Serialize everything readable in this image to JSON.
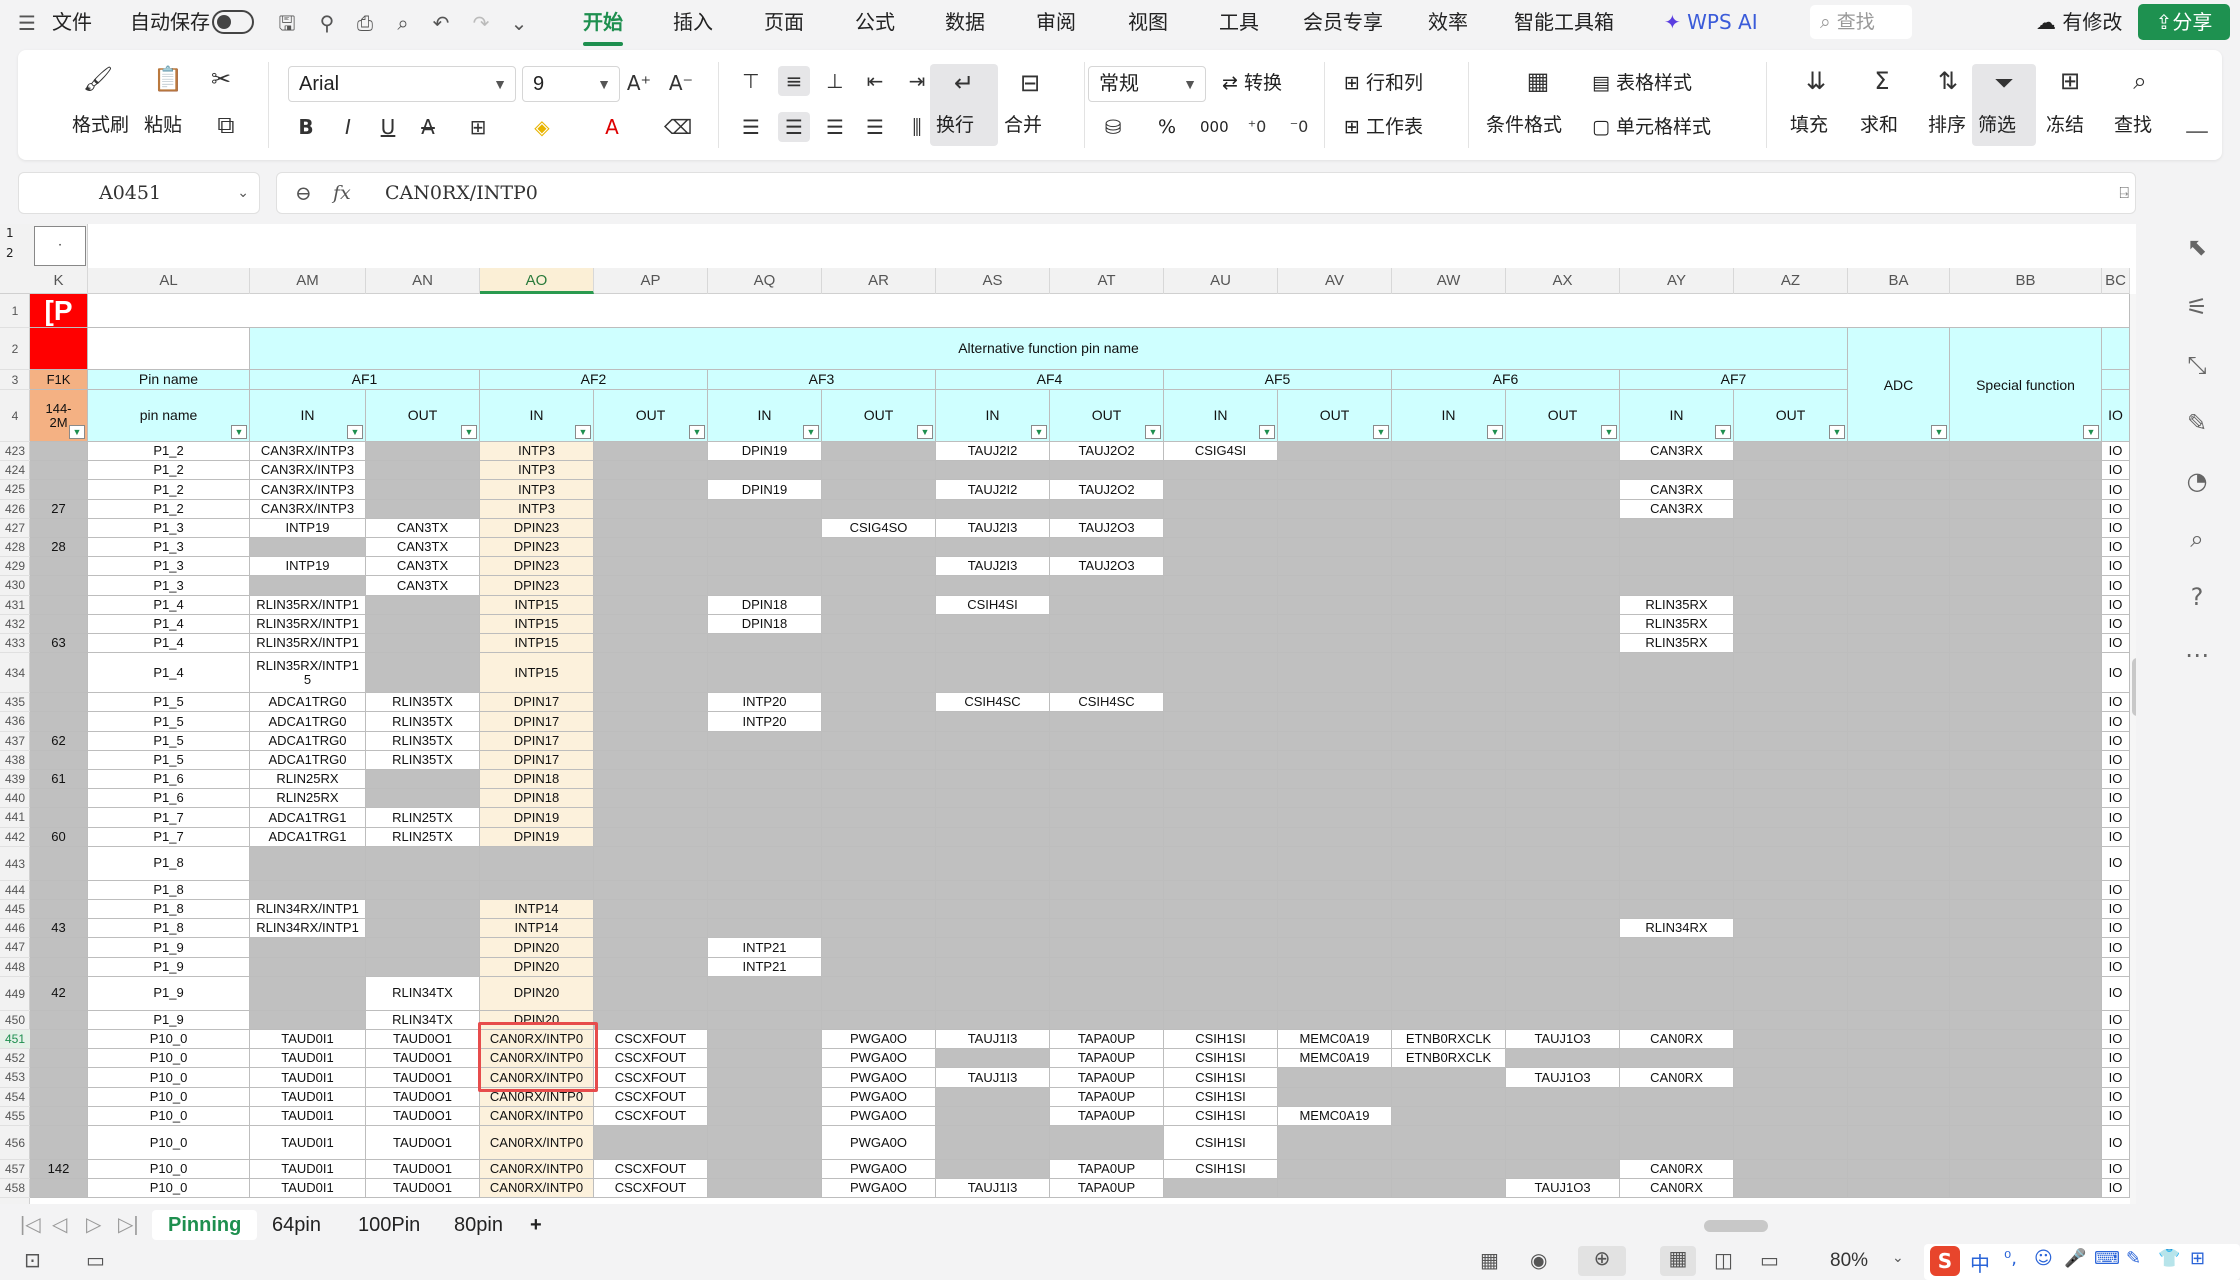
{
  "menu": {
    "file": "文件",
    "autosave": "自动保存",
    "tabs": [
      "开始",
      "插入",
      "页面",
      "公式",
      "数据",
      "审阅",
      "视图",
      "工具",
      "会员专享",
      "效率",
      "智能工具箱"
    ],
    "wps_ai": "WPS AI",
    "search": "查找",
    "modify": "有修改",
    "share": "分享"
  },
  "ribbon": {
    "format_painter": "格式刷",
    "paste": "粘贴",
    "font": "Arial",
    "size": "9",
    "wrap": "换行",
    "merge": "合并",
    "numfmt": "常规",
    "convert": "转换",
    "rowcol": "行和列",
    "sheet": "工作表",
    "cond": "条件格式",
    "tablestyle": "表格样式",
    "cellstyle": "单元格样式",
    "fill": "填充",
    "sum": "求和",
    "sort": "排序",
    "filter": "筛选",
    "freeze": "冻结",
    "find": "查找",
    "pct": "%",
    "k000": "000"
  },
  "formula_bar": {
    "cell": "A0451",
    "fx": "fx",
    "value": "CAN0RX/INTP0"
  },
  "headers": {
    "cols": [
      "K",
      "AL",
      "AM",
      "AN",
      "AO",
      "AP",
      "AQ",
      "AR",
      "AS",
      "AT",
      "AU",
      "AV",
      "AW",
      "AX",
      "AY",
      "AZ",
      "BA",
      "BB",
      "BC"
    ],
    "selected_col": "AO",
    "outline": [
      "1",
      "2"
    ],
    "outline_dot": "·"
  },
  "fixed": {
    "r1k": "[P",
    "r3k": "F1K",
    "r4k": "144-\n2M",
    "pin_name": "Pin name",
    "pin_name2": "pin name",
    "alt": "Alternative function pin name",
    "af": [
      "AF1",
      "AF2",
      "AF3",
      "AF4",
      "AF5",
      "AF6",
      "AF7"
    ],
    "in": "IN",
    "out": "OUT",
    "adc": "ADC",
    "special": "Special function",
    "io": "IO"
  },
  "rows": [
    [
      "423",
      "",
      "P1_2",
      "CAN3RX/INTP3",
      "",
      "INTP3",
      "",
      "DPIN19",
      "",
      "TAUJ2I2",
      "TAUJ2O2",
      "CSIG4SI",
      "",
      "",
      "",
      "CAN3RX",
      ""
    ],
    [
      "424",
      "",
      "P1_2",
      "CAN3RX/INTP3",
      "",
      "INTP3",
      "",
      "",
      "",
      "",
      "",
      "",
      "",
      "",
      "",
      "",
      ""
    ],
    [
      "425",
      "",
      "P1_2",
      "CAN3RX/INTP3",
      "",
      "INTP3",
      "",
      "DPIN19",
      "",
      "TAUJ2I2",
      "TAUJ2O2",
      "",
      "",
      "",
      "",
      "CAN3RX",
      ""
    ],
    [
      "426",
      "27",
      "P1_2",
      "CAN3RX/INTP3",
      "",
      "INTP3",
      "",
      "",
      "",
      "",
      "",
      "",
      "",
      "",
      "",
      "CAN3RX",
      ""
    ],
    [
      "427",
      "",
      "P1_3",
      "INTP19",
      "CAN3TX",
      "DPIN23",
      "",
      "",
      "CSIG4SO",
      "TAUJ2I3",
      "TAUJ2O3",
      "",
      "",
      "",
      "",
      "",
      ""
    ],
    [
      "428",
      "28",
      "P1_3",
      "",
      "CAN3TX",
      "DPIN23",
      "",
      "",
      "",
      "",
      "",
      "",
      "",
      "",
      "",
      "",
      ""
    ],
    [
      "429",
      "",
      "P1_3",
      "INTP19",
      "CAN3TX",
      "DPIN23",
      "",
      "",
      "",
      "TAUJ2I3",
      "TAUJ2O3",
      "",
      "",
      "",
      "",
      "",
      ""
    ],
    [
      "430",
      "",
      "P1_3",
      "",
      "CAN3TX",
      "DPIN23",
      "",
      "",
      "",
      "",
      "",
      "",
      "",
      "",
      "",
      "",
      ""
    ],
    [
      "431",
      "",
      "P1_4",
      "RLIN35RX/INTP1",
      "",
      "INTP15",
      "",
      "DPIN18",
      "",
      "CSIH4SI",
      "",
      "",
      "",
      "",
      "",
      "RLIN35RX",
      ""
    ],
    [
      "432",
      "",
      "P1_4",
      "RLIN35RX/INTP1",
      "",
      "INTP15",
      "",
      "DPIN18",
      "",
      "",
      "",
      "",
      "",
      "",
      "",
      "RLIN35RX",
      ""
    ],
    [
      "433",
      "63",
      "P1_4",
      "RLIN35RX/INTP1",
      "",
      "INTP15",
      "",
      "",
      "",
      "",
      "",
      "",
      "",
      "",
      "",
      "RLIN35RX",
      ""
    ],
    [
      "434",
      "",
      "P1_4",
      "RLIN35RX/INTP1\n5",
      "",
      "INTP15",
      "",
      "",
      "",
      "",
      "",
      "",
      "",
      "",
      "",
      "",
      ""
    ],
    [
      "435",
      "",
      "P1_5",
      "ADCA1TRG0",
      "RLIN35TX",
      "DPIN17",
      "",
      "INTP20",
      "",
      "CSIH4SC",
      "CSIH4SC",
      "",
      "",
      "",
      "",
      "",
      ""
    ],
    [
      "436",
      "",
      "P1_5",
      "ADCA1TRG0",
      "RLIN35TX",
      "DPIN17",
      "",
      "INTP20",
      "",
      "",
      "",
      "",
      "",
      "",
      "",
      "",
      ""
    ],
    [
      "437",
      "62",
      "P1_5",
      "ADCA1TRG0",
      "RLIN35TX",
      "DPIN17",
      "",
      "",
      "",
      "",
      "",
      "",
      "",
      "",
      "",
      "",
      ""
    ],
    [
      "438",
      "",
      "P1_5",
      "ADCA1TRG0",
      "RLIN35TX",
      "DPIN17",
      "",
      "",
      "",
      "",
      "",
      "",
      "",
      "",
      "",
      "",
      ""
    ],
    [
      "439",
      "61",
      "P1_6",
      "RLIN25RX",
      "",
      "DPIN18",
      "",
      "",
      "",
      "",
      "",
      "",
      "",
      "",
      "",
      "",
      ""
    ],
    [
      "440",
      "",
      "P1_6",
      "RLIN25RX",
      "",
      "DPIN18",
      "",
      "",
      "",
      "",
      "",
      "",
      "",
      "",
      "",
      "",
      ""
    ],
    [
      "441",
      "",
      "P1_7",
      "ADCA1TRG1",
      "RLIN25TX",
      "DPIN19",
      "",
      "",
      "",
      "",
      "",
      "",
      "",
      "",
      "",
      "",
      ""
    ],
    [
      "442",
      "60",
      "P1_7",
      "ADCA1TRG1",
      "RLIN25TX",
      "DPIN19",
      "",
      "",
      "",
      "",
      "",
      "",
      "",
      "",
      "",
      "",
      ""
    ],
    [
      "443",
      "",
      "P1_8",
      "",
      "",
      "",
      "",
      "",
      "",
      "",
      "",
      "",
      "",
      "",
      "",
      "",
      ""
    ],
    [
      "444",
      "",
      "P1_8",
      "",
      "",
      "",
      "",
      "",
      "",
      "",
      "",
      "",
      "",
      "",
      "",
      "",
      ""
    ],
    [
      "445",
      "",
      "P1_8",
      "RLIN34RX/INTP1",
      "",
      "INTP14",
      "",
      "",
      "",
      "",
      "",
      "",
      "",
      "",
      "",
      "",
      ""
    ],
    [
      "446",
      "43",
      "P1_8",
      "RLIN34RX/INTP1",
      "",
      "INTP14",
      "",
      "",
      "",
      "",
      "",
      "",
      "",
      "",
      "",
      "RLIN34RX",
      ""
    ],
    [
      "447",
      "",
      "P1_9",
      "",
      "",
      "DPIN20",
      "",
      "INTP21",
      "",
      "",
      "",
      "",
      "",
      "",
      "",
      "",
      ""
    ],
    [
      "448",
      "",
      "P1_9",
      "",
      "",
      "DPIN20",
      "",
      "INTP21",
      "",
      "",
      "",
      "",
      "",
      "",
      "",
      "",
      ""
    ],
    [
      "449",
      "42",
      "P1_9",
      "",
      "RLIN34TX",
      "DPIN20",
      "",
      "",
      "",
      "",
      "",
      "",
      "",
      "",
      "",
      "",
      ""
    ],
    [
      "450",
      "",
      "P1_9",
      "",
      "RLIN34TX",
      "DPIN20",
      "",
      "",
      "",
      "",
      "",
      "",
      "",
      "",
      "",
      "",
      ""
    ],
    [
      "451",
      "",
      "P10_0",
      "TAUD0I1",
      "TAUD0O1",
      "CAN0RX/INTP0",
      "CSCXFOUT",
      "",
      "PWGA0O",
      "TAUJ1I3",
      "TAPA0UP",
      "CSIH1SI",
      "MEMC0A19",
      "ETNB0RXCLK",
      "TAUJ1O3",
      "CAN0RX",
      ""
    ],
    [
      "452",
      "",
      "P10_0",
      "TAUD0I1",
      "TAUD0O1",
      "CAN0RX/INTP0",
      "CSCXFOUT",
      "",
      "PWGA0O",
      "",
      "TAPA0UP",
      "CSIH1SI",
      "MEMC0A19",
      "ETNB0RXCLK",
      "",
      "",
      ""
    ],
    [
      "453",
      "",
      "P10_0",
      "TAUD0I1",
      "TAUD0O1",
      "CAN0RX/INTP0",
      "CSCXFOUT",
      "",
      "PWGA0O",
      "TAUJ1I3",
      "TAPA0UP",
      "CSIH1SI",
      "",
      "",
      "TAUJ1O3",
      "CAN0RX",
      ""
    ],
    [
      "454",
      "",
      "P10_0",
      "TAUD0I1",
      "TAUD0O1",
      "CAN0RX/INTP0",
      "CSCXFOUT",
      "",
      "PWGA0O",
      "",
      "TAPA0UP",
      "CSIH1SI",
      "",
      "",
      "",
      "",
      ""
    ],
    [
      "455",
      "",
      "P10_0",
      "TAUD0I1",
      "TAUD0O1",
      "CAN0RX/INTP0",
      "CSCXFOUT",
      "",
      "PWGA0O",
      "",
      "TAPA0UP",
      "CSIH1SI",
      "MEMC0A19",
      "",
      "",
      "",
      ""
    ],
    [
      "456",
      "",
      "P10_0",
      "TAUD0I1",
      "TAUD0O1",
      "CAN0RX/INTP0",
      "",
      "",
      "PWGA0O",
      "",
      "",
      "CSIH1SI",
      "",
      "",
      "",
      "",
      ""
    ],
    [
      "457",
      "142",
      "P10_0",
      "TAUD0I1",
      "TAUD0O1",
      "CAN0RX/INTP0",
      "CSCXFOUT",
      "",
      "PWGA0O",
      "",
      "TAPA0UP",
      "CSIH1SI",
      "",
      "",
      "",
      "CAN0RX",
      ""
    ],
    [
      "458",
      "",
      "P10_0",
      "TAUD0I1",
      "TAUD0O1",
      "CAN0RX/INTP0",
      "CSCXFOUT",
      "",
      "PWGA0O",
      "TAUJ1I3",
      "TAPA0UP",
      "",
      "",
      "",
      "TAUJ1O3",
      "CAN0RX",
      ""
    ]
  ],
  "sheets": [
    "Pinning",
    "64pin",
    "100Pin",
    "80pin"
  ],
  "add_sheet": "+",
  "status": {
    "zoom": "80%",
    "ime": "中"
  }
}
